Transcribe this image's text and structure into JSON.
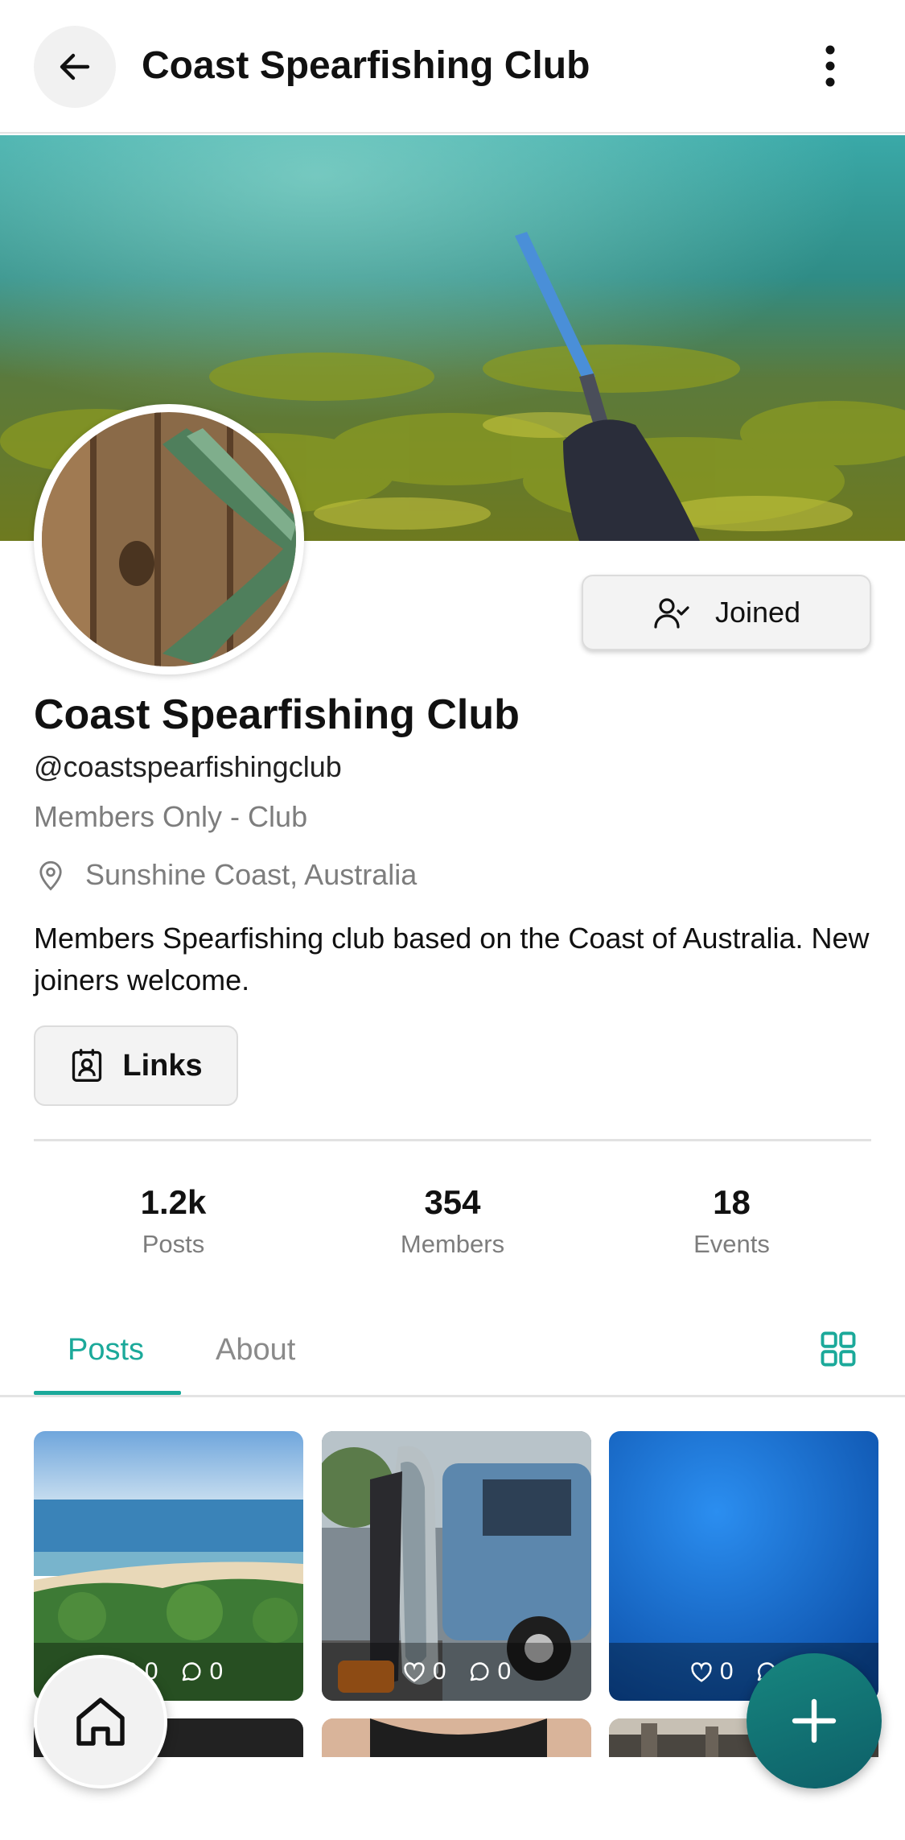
{
  "header": {
    "title": "Coast Spearfishing Club",
    "back_icon": "arrow-left-icon",
    "more_icon": "more-vertical-icon"
  },
  "profile": {
    "name": "Coast Spearfishing Club",
    "handle": "@coastspearfishingclub",
    "type": "Members Only - Club",
    "location": "Sunshine Coast, Australia",
    "description": "Members Spearfishing club based on the Coast of Australia. New joiners welcome.",
    "joined_label": "Joined",
    "links_label": "Links"
  },
  "stats": [
    {
      "value": "1.2k",
      "label": "Posts"
    },
    {
      "value": "354",
      "label": "Members"
    },
    {
      "value": "18",
      "label": "Events"
    }
  ],
  "tabs": {
    "posts": "Posts",
    "about": "About",
    "active": "Posts"
  },
  "posts": [
    {
      "likes": "0",
      "comments": "0"
    },
    {
      "likes": "0",
      "comments": "0"
    },
    {
      "likes": "0",
      "comments": "0"
    }
  ],
  "colors": {
    "accent": "#1ba99a",
    "fab": "#0d5f68",
    "muted_text": "#7d7d7d"
  }
}
